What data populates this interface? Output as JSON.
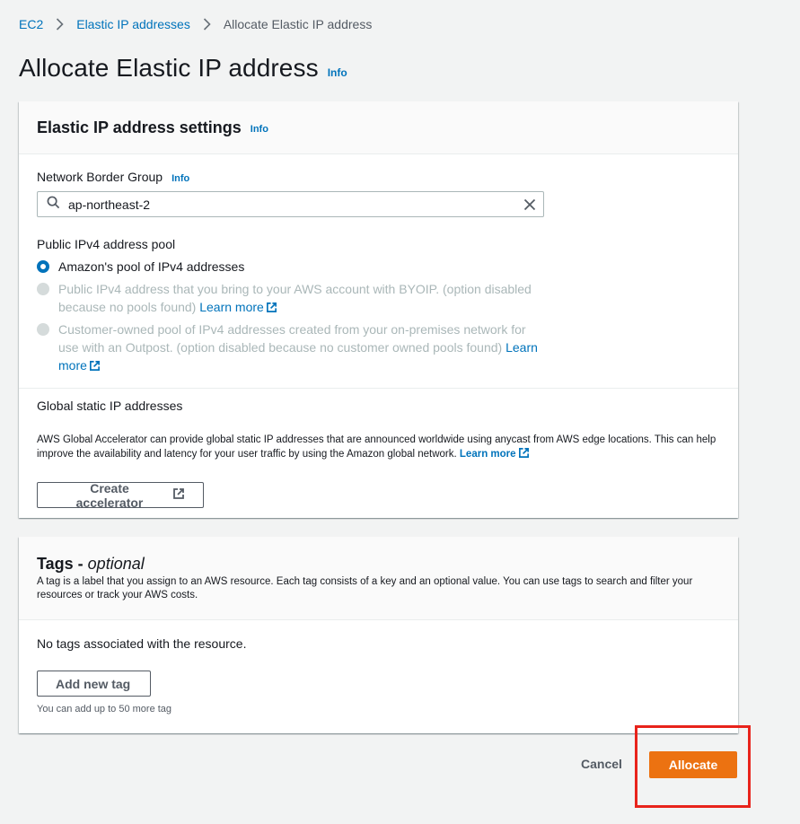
{
  "breadcrumb": {
    "items": [
      "EC2",
      "Elastic IP addresses"
    ],
    "current": "Allocate Elastic IP address"
  },
  "page": {
    "title": "Allocate Elastic IP address",
    "info": "Info"
  },
  "settings": {
    "title": "Elastic IP address settings",
    "info": "Info",
    "network_border_group": {
      "label": "Network Border Group",
      "info": "Info",
      "value": "ap-northeast-2"
    },
    "address_pool": {
      "label": "Public IPv4 address pool",
      "options": [
        {
          "text": "Amazon's pool of IPv4 addresses",
          "checked": true,
          "disabled": false
        },
        {
          "text": "Public IPv4 address that you bring to your AWS account with BYOIP. (option disabled because no pools found)",
          "link": "Learn more",
          "checked": false,
          "disabled": true
        },
        {
          "text": "Customer-owned pool of IPv4 addresses created from your on-premises network for use with an Outpost. (option disabled because no customer owned pools found)",
          "link": "Learn more",
          "checked": false,
          "disabled": true
        }
      ]
    },
    "global_static": {
      "label": "Global static IP addresses",
      "description": "AWS Global Accelerator can provide global static IP addresses that are announced worldwide using anycast from AWS edge locations. This can help improve the availability and latency for your user traffic by using the Amazon global network.",
      "link": "Learn more",
      "button": "Create accelerator"
    }
  },
  "tags": {
    "title": "Tags - ",
    "title_optional": "optional",
    "description": "A tag is a label that you assign to an AWS resource. Each tag consists of a key and an optional value. You can use tags to search and filter your resources or track your AWS costs.",
    "empty": "No tags associated with the resource.",
    "add_button": "Add new tag",
    "hint": "You can add up to 50 more tag"
  },
  "actions": {
    "cancel": "Cancel",
    "allocate": "Allocate"
  },
  "colors": {
    "link": "#0073bb",
    "primary": "#ec7211",
    "highlight": "#e8231b"
  }
}
